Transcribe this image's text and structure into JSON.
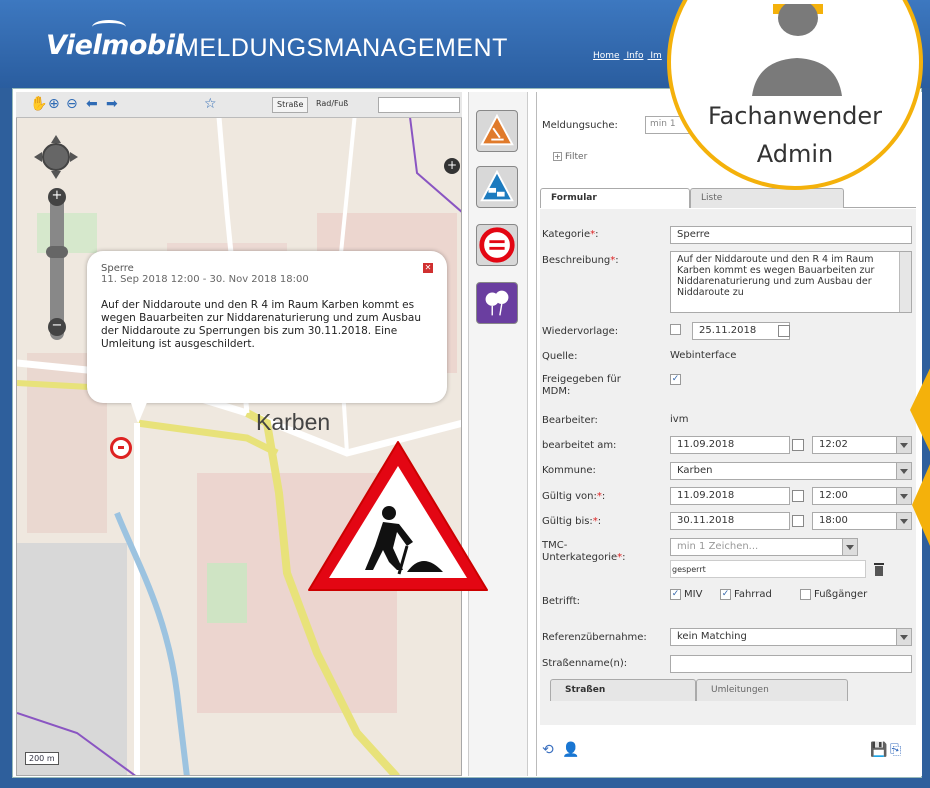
{
  "header": {
    "logo": "Vielmobil",
    "title": "MELDUNGSMANAGEMENT",
    "nav": [
      "Home",
      "Info",
      "Im"
    ]
  },
  "map": {
    "toolbar": {
      "street_button": "Straße",
      "bike_button": "Rad/Fuß"
    },
    "popup": {
      "category": "Sperre",
      "date_range": "11. Sep 2018 12:00 - 30. Nov 2018 18:00",
      "text": "Auf der Niddaroute und den R 4 im Raum Karben kommt es wegen Bauarbeiten zur Niddarenaturierung und zum Ausbau der Niddaroute zu Sperrungen bis zum 30.11.2018. Eine Umleitung ist ausgeschildert."
    },
    "city_label": "Karben",
    "scale": "200 m"
  },
  "form": {
    "search_label": "Meldungsuche:",
    "search_placeholder": "min 1",
    "filter_label": "Filter",
    "tabs": [
      "Formular",
      "Liste"
    ],
    "fields": {
      "kategorie_label": "Kategorie",
      "kategorie_value": "Sperre",
      "beschreibung_label": "Beschreibung",
      "beschreibung_value": "Auf der Niddaroute und den R 4 im Raum Karben kommt es wegen Bauarbeiten zur Niddarenaturierung und zum Ausbau der Niddaroute zu",
      "wiedervorlage_label": "Wiedervorlage:",
      "wiedervorlage_value": "25.11.2018",
      "quelle_label": "Quelle:",
      "quelle_value": "Webinterface",
      "freigegeben_label": "Freigegeben für MDM:",
      "bearbeiter_label": "Bearbeiter:",
      "bearbeiter_value": "ivm",
      "bearbeitet_label": "bearbeitet am:",
      "bearbeitet_date": "11.09.2018",
      "bearbeitet_time": "12:02",
      "kommune_label": "Kommune:",
      "kommune_value": "Karben",
      "gueltig_von_label": "Gültig von:",
      "gueltig_von_date": "11.09.2018",
      "gueltig_von_time": "12:00",
      "gueltig_bis_label": "Gültig bis:",
      "gueltig_bis_date": "30.11.2018",
      "gueltig_bis_time": "18:00",
      "tmc_label": "TMC-Unterkategorie",
      "tmc_placeholder": "min 1 Zeichen...",
      "tmc_chip": "gesperrt",
      "betrifft_label": "Betrifft:",
      "betrifft_options": [
        "MIV",
        "Fahrrad",
        "Fußgänger"
      ],
      "referenz_label": "Referenzübernahme:",
      "referenz_value": "kein Matching",
      "strassenname_label": "Straßenname(n):"
    },
    "bottom_tabs": [
      "Straßen",
      "Umleitungen"
    ]
  },
  "badge": {
    "role_line1": "Fachanwender",
    "role_line2": "Admin"
  },
  "colors": {
    "header_blue": "#2a5d9f",
    "badge_gold": "#f4b10b",
    "sign_red": "#e30613"
  }
}
